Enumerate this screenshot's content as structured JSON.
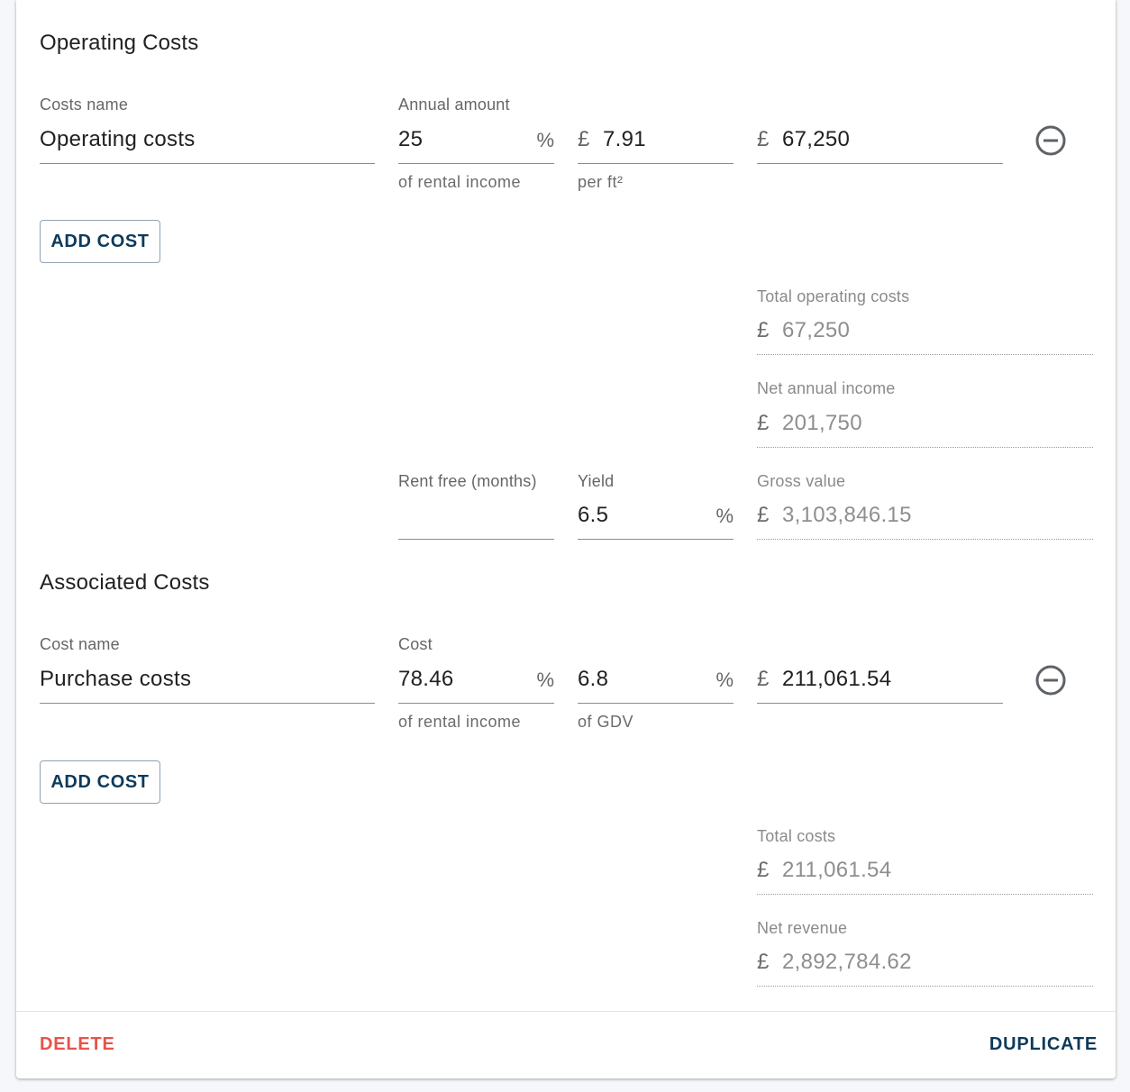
{
  "operating": {
    "title": "Operating Costs",
    "costs_name_label": "Costs name",
    "annual_amount_label": "Annual amount",
    "row": {
      "name": "Operating costs",
      "percent": "25",
      "percent_suffix": "%",
      "percent_helper": "of rental income",
      "per_ft_prefix": "£",
      "per_ft": "7.91",
      "per_ft_helper": "per ft²",
      "amount_prefix": "£",
      "amount": "67,250"
    },
    "add_cost": "ADD COST",
    "total_label": "Total operating costs",
    "total_prefix": "£",
    "total": "67,250",
    "net_income_label": "Net annual income",
    "net_income_prefix": "£",
    "net_income": "201,750",
    "rent_free_label": "Rent free (months)",
    "rent_free": "",
    "yield_label": "Yield",
    "yield": "6.5",
    "yield_suffix": "%",
    "gross_label": "Gross value",
    "gross_prefix": "£",
    "gross": "3,103,846.15"
  },
  "associated": {
    "title": "Associated Costs",
    "cost_name_label": "Cost name",
    "cost_label": "Cost",
    "row": {
      "name": "Purchase costs",
      "percent": "78.46",
      "percent_suffix": "%",
      "percent_helper": "of rental income",
      "gdv_percent": "6.8",
      "gdv_suffix": "%",
      "gdv_helper": "of GDV",
      "amount_prefix": "£",
      "amount": "211,061.54"
    },
    "add_cost": "ADD COST",
    "total_label": "Total costs",
    "total_prefix": "£",
    "total": "211,061.54",
    "net_revenue_label": "Net revenue",
    "net_revenue_prefix": "£",
    "net_revenue": "2,892,784.62"
  },
  "footer": {
    "delete": "DELETE",
    "duplicate": "DUPLICATE"
  },
  "colors": {
    "primary": "#0d3a5a",
    "danger": "#e8534a"
  },
  "icons": {
    "remove": "minus-circle-icon"
  }
}
